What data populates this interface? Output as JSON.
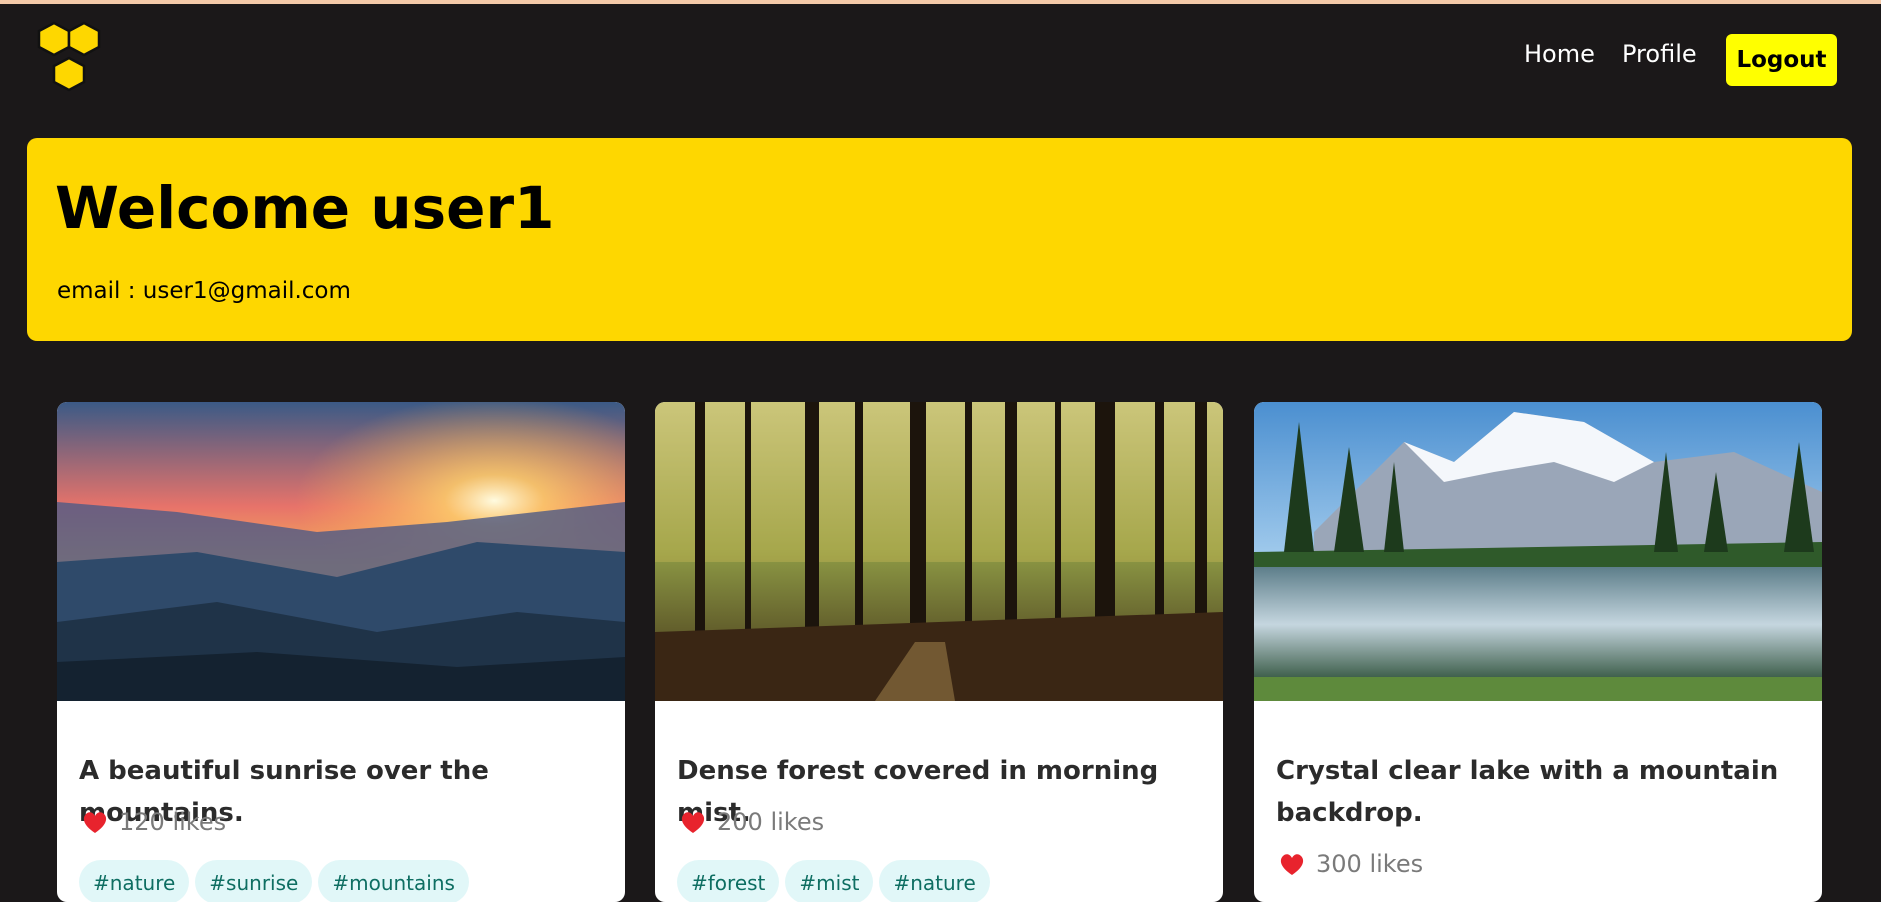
{
  "nav": {
    "home": "Home",
    "profile": "Profile",
    "logout": "Logout",
    "logo_icon": "honeycomb-logo-icon"
  },
  "welcome": {
    "title": "Welcome user1",
    "email": "email : user1@gmail.com"
  },
  "posts": [
    {
      "image": "sunrise-mountains-photo",
      "title": "A beautiful sunrise over the mountains.",
      "likes": "120 likes",
      "tags": [
        "#nature",
        "#sunrise",
        "#mountains"
      ]
    },
    {
      "image": "misty-forest-photo",
      "title": "Dense forest covered in morning mist.",
      "likes": "200 likes",
      "tags": [
        "#forest",
        "#mist",
        "#nature"
      ]
    },
    {
      "image": "mountain-lake-photo",
      "title": "Crystal clear lake with a mountain backdrop.",
      "likes": "300 likes",
      "tags": []
    }
  ],
  "colors": {
    "background": "#1b1819",
    "accent_yellow": "#fed700",
    "logout_yellow": "#ffff00",
    "tag_bg": "#e1f7f8",
    "tag_text": "#0e6e62",
    "heart": "#e8232d"
  }
}
